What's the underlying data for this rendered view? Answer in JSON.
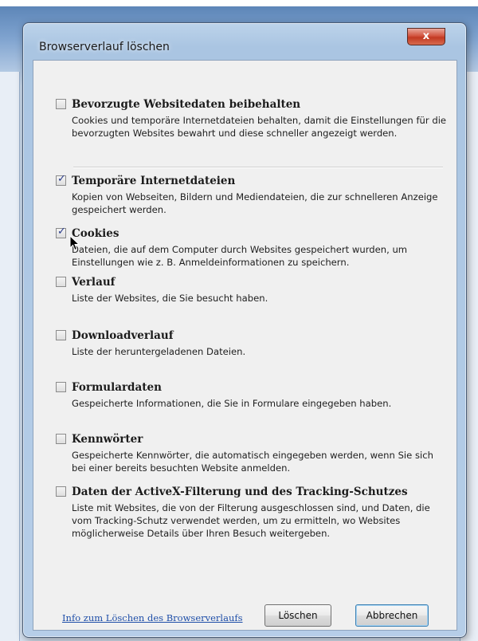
{
  "dialog": {
    "title": "Browserverlauf löschen",
    "close_label": "x"
  },
  "options": [
    {
      "title": "Bevorzugte Websitedaten beibehalten",
      "checked": false,
      "desc": "Cookies und temporäre Internetdateien behalten, damit die Einstellungen für die bevorzugten Websites bewahrt und diese schneller angezeigt werden."
    },
    {
      "title": "Temporäre Internetdateien",
      "checked": true,
      "desc": "Kopien von Webseiten, Bildern und Mediendateien, die zur schnelleren Anzeige gespeichert werden."
    },
    {
      "title": "Cookies",
      "checked": true,
      "desc": "Dateien, die auf dem Computer durch Websites gespeichert wurden, um Einstellungen wie z. B. Anmeldeinformationen zu speichern."
    },
    {
      "title": "Verlauf",
      "checked": false,
      "desc": "Liste der Websites, die Sie besucht haben."
    },
    {
      "title": "Downloadverlauf",
      "checked": false,
      "desc": "Liste der heruntergeladenen Dateien."
    },
    {
      "title": "Formulardaten",
      "checked": false,
      "desc": "Gespeicherte Informationen, die Sie in Formulare eingegeben haben."
    },
    {
      "title": "Kennwörter",
      "checked": false,
      "desc": "Gespeicherte Kennwörter, die automatisch eingegeben werden, wenn Sie sich bei einer bereits besuchten Website anmelden."
    },
    {
      "title": "Daten der ActiveX-Filterung und des Tracking-Schutzes",
      "checked": false,
      "desc": "Liste mit Websites, die von der Filterung ausgeschlossen sind, und Daten, die vom Tracking-Schutz verwendet werden, um zu ermitteln, wo Websites möglicherweise Details über Ihren Besuch weitergeben."
    }
  ],
  "footer": {
    "info_link": "Info zum Löschen des Browserverlaufs",
    "delete_label": "Löschen",
    "cancel_label": "Abbrechen"
  },
  "icons": {
    "checkmark": "check-icon",
    "cursor": "mouse-pointer-icon"
  }
}
